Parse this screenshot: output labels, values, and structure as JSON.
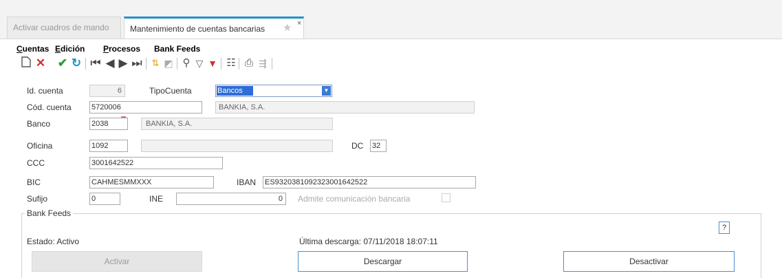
{
  "tabs": [
    {
      "label": "Activar cuadros de mando"
    },
    {
      "label": "Mantenimiento de cuentas bancarias"
    }
  ],
  "menu": [
    {
      "accel": "C",
      "rest": "uentas"
    },
    {
      "accel": "E",
      "rest": "dición"
    },
    {
      "accel": "P",
      "rest": "rocesos"
    },
    {
      "accel": "",
      "rest": "Bank Feeds"
    }
  ],
  "toolbar": [
    "new-icon",
    "delete-icon",
    "accept-icon",
    "undo-icon",
    "first-record-icon",
    "previous-record-icon",
    "next-record-icon",
    "last-record-icon",
    "sort-icon",
    "edit-filter-icon",
    "search-icon",
    "filter-icon",
    "clear-filter-icon",
    "grid-view-icon",
    "print-icon",
    "export-icon"
  ],
  "form": {
    "id_cuenta": {
      "label": "Id. cuenta",
      "value": "6"
    },
    "tipo_cuenta": {
      "label": "TipoCuenta",
      "value": "Bancos"
    },
    "cod_cuenta": {
      "label": "Cód. cuenta",
      "value": "5720006",
      "desc": "BANKIA, S.A."
    },
    "banco": {
      "label": "Banco",
      "value": "2038",
      "desc": "BANKIA, S.A."
    },
    "oficina": {
      "label": "Oficina",
      "value": "1092",
      "desc": ""
    },
    "dc": {
      "label": "DC",
      "value": "32"
    },
    "ccc": {
      "label": "CCC",
      "value": "3001642522"
    },
    "bic": {
      "label": "BIC",
      "value": "CAHMESMMXXX"
    },
    "iban": {
      "label": "IBAN",
      "value": "ES9320381092323001642522"
    },
    "sufijo": {
      "label": "Sufijo",
      "value": "0"
    },
    "ine": {
      "label": "INE",
      "value": "0"
    },
    "admite": {
      "label": "Admite comunicación bancaria"
    }
  },
  "bank_feeds": {
    "title": "Bank Feeds",
    "estado": "Estado: Activo",
    "ultima_descarga": "Última descarga: 07/11/2018 18:07:11",
    "help": "?",
    "btn_activar": "Activar",
    "btn_descargar": "Descargar",
    "btn_desactivar": "Desactivar"
  },
  "colors": {
    "accent": "#1d94c7",
    "button_border": "#4a8ecf",
    "selection": "#2e6cd8"
  }
}
